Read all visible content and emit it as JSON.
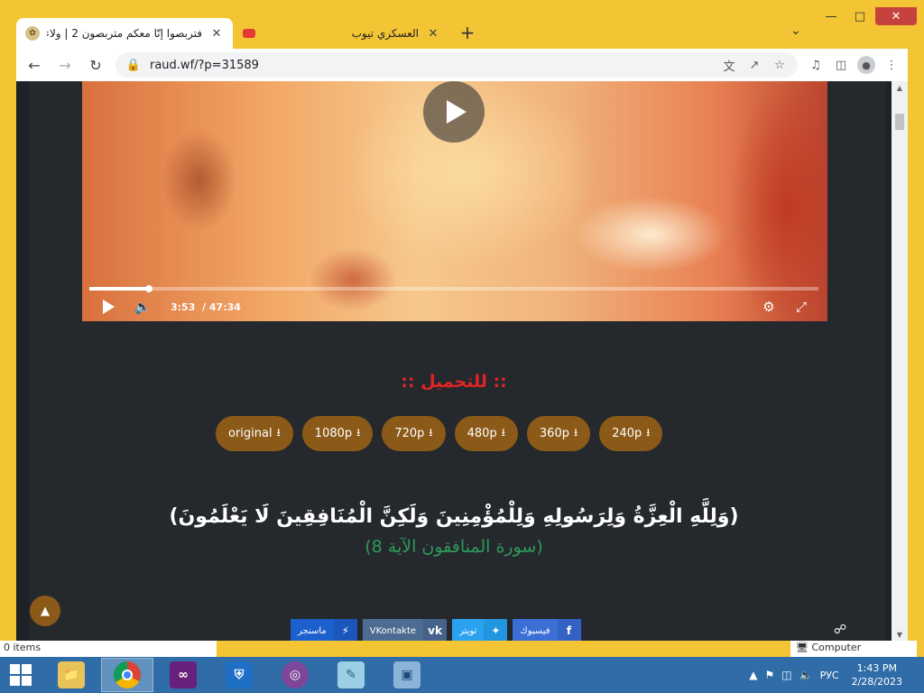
{
  "browser": {
    "tabs": [
      {
        "title": "فتربصوا إنّا معكم متربصون 2 | ولاء",
        "active": true
      },
      {
        "title": "العسكري تيوب",
        "active": false
      }
    ],
    "new_tab": "+",
    "url": "raud.wf/?p=31589"
  },
  "video": {
    "current_time": "3:53",
    "duration": "47:34",
    "progress_fraction": 0.082
  },
  "download": {
    "heading": ":: للتحميل ::",
    "buttons": [
      "original",
      "1080p",
      "720p",
      "480p",
      "360p",
      "240p"
    ]
  },
  "verse": {
    "text": "(وَلِلَّهِ الْعِزَّةُ وَلِرَسُولِهِ وَلِلْمُؤْمِنِينَ وَلَكِنَّ الْمُنَافِقِينَ لَا يَعْلَمُونَ)",
    "reference": "(سورة المنافقون الآية 8)"
  },
  "share": {
    "buttons": [
      {
        "label": "ماسنجر",
        "icon": "messenger-icon"
      },
      {
        "label": "VKontakte",
        "icon": "vk-icon"
      },
      {
        "label": "تويتر",
        "icon": "twitter-icon"
      },
      {
        "label": "فيسبوك",
        "icon": "facebook-icon"
      }
    ]
  },
  "explorer": {
    "items_count": "0 items",
    "computer_label": "Computer"
  },
  "taskbar": {
    "language": "РУС",
    "time": "1:43 PM",
    "date": "2/28/2023"
  },
  "colors": {
    "window_frame": "#f3c433",
    "page_bg": "#25282d",
    "download_heading": "#e02424",
    "button_brown": "#8b5a18",
    "verse_ref_green": "#2e9a5a",
    "taskbar": "#2f6ca8"
  }
}
